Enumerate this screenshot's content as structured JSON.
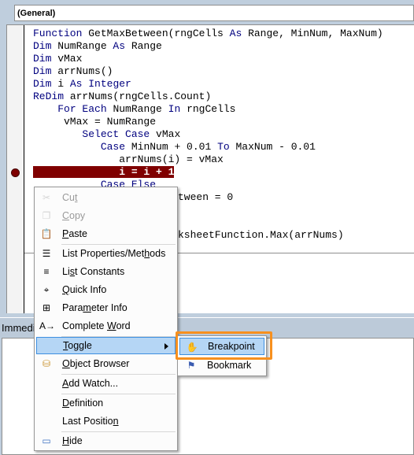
{
  "procedure_dropdown": "(General)",
  "code_lines": [
    [
      {
        "t": "Function",
        "k": 1
      },
      {
        "t": " GetMaxBetween(rngCells "
      },
      {
        "t": "As",
        "k": 1
      },
      {
        "t": " Range, MinNum, MaxNum)"
      }
    ],
    [
      {
        "t": "Dim",
        "k": 1
      },
      {
        "t": " NumRange "
      },
      {
        "t": "As",
        "k": 1
      },
      {
        "t": " Range"
      }
    ],
    [
      {
        "t": "Dim",
        "k": 1
      },
      {
        "t": " vMax"
      }
    ],
    [
      {
        "t": "Dim",
        "k": 1
      },
      {
        "t": " arrNums()"
      }
    ],
    [
      {
        "t": "Dim",
        "k": 1
      },
      {
        "t": " i "
      },
      {
        "t": "As",
        "k": 1
      },
      {
        "t": " "
      },
      {
        "t": "Integer",
        "k": 1
      }
    ],
    [
      {
        "t": "ReDim",
        "k": 1
      },
      {
        "t": " arrNums(rngCells.Count)"
      }
    ],
    [
      {
        "t": "    "
      },
      {
        "t": "For Each",
        "k": 1
      },
      {
        "t": " NumRange "
      },
      {
        "t": "In",
        "k": 1
      },
      {
        "t": " rngCells"
      }
    ],
    [
      {
        "t": "     vMax = NumRange"
      }
    ],
    [
      {
        "t": "        "
      },
      {
        "t": "Select Case",
        "k": 1
      },
      {
        "t": " vMax"
      }
    ],
    [
      {
        "t": "           "
      },
      {
        "t": "Case",
        "k": 1
      },
      {
        "t": " MinNum + 0.01 "
      },
      {
        "t": "To",
        "k": 1
      },
      {
        "t": " MaxNum - 0.01"
      }
    ],
    [
      {
        "t": "              arrNums(i) = vMax"
      }
    ],
    [
      {
        "t": "              i = i + 1",
        "h": 1
      }
    ],
    [
      {
        "t": "           "
      },
      {
        "t": "Case Else",
        "k": 1
      }
    ]
  ],
  "partial_lines": [
    "tween = 0",
    "ksheetFunction.Max(arrNums)"
  ],
  "immediate_label": "Immedi",
  "context_menu": {
    "items": [
      {
        "pre": "Cu",
        "acc": "t",
        "post": "",
        "icon": "scissors-icon",
        "disabled": true
      },
      {
        "pre": "",
        "acc": "C",
        "post": "opy",
        "icon": "copy-icon",
        "disabled": true
      },
      {
        "pre": "",
        "acc": "P",
        "post": "aste",
        "icon": "paste-icon"
      },
      {
        "pre": "List Properties/Met",
        "acc": "h",
        "post": "ods",
        "icon": "list-properties-icon"
      },
      {
        "pre": "Li",
        "acc": "s",
        "post": "t Constants",
        "icon": "list-constants-icon"
      },
      {
        "pre": "",
        "acc": "Q",
        "post": "uick Info",
        "icon": "quick-info-icon"
      },
      {
        "pre": "Para",
        "acc": "m",
        "post": "eter Info",
        "icon": "parameter-info-icon"
      },
      {
        "pre": "Complete ",
        "acc": "W",
        "post": "ord",
        "icon": "complete-word-icon"
      },
      {
        "pre": "",
        "acc": "T",
        "post": "oggle",
        "submenu": true,
        "selected": true
      },
      {
        "pre": "",
        "acc": "O",
        "post": "bject Browser",
        "icon": "object-browser-icon"
      },
      {
        "pre": "",
        "acc": "A",
        "post": "dd Watch...",
        "icon": ""
      },
      {
        "pre": "",
        "acc": "D",
        "post": "efinition",
        "icon": ""
      },
      {
        "pre": "Last Positio",
        "acc": "n",
        "post": "",
        "icon": ""
      },
      {
        "pre": "",
        "acc": "H",
        "post": "ide",
        "icon": "hide-icon"
      }
    ],
    "separators_after": [
      2,
      7,
      9,
      10,
      12
    ]
  },
  "toggle_submenu": {
    "items": [
      {
        "label": "Breakpoint",
        "icon": "hand-icon",
        "selected": true
      },
      {
        "label": "Bookmark",
        "icon": "bookmark-icon"
      }
    ]
  },
  "colors": {
    "highlight_outline": "#f7901e",
    "breakpoint": "#800000",
    "keyword": "#00007f",
    "menu_selection": "#b5d6f5"
  }
}
